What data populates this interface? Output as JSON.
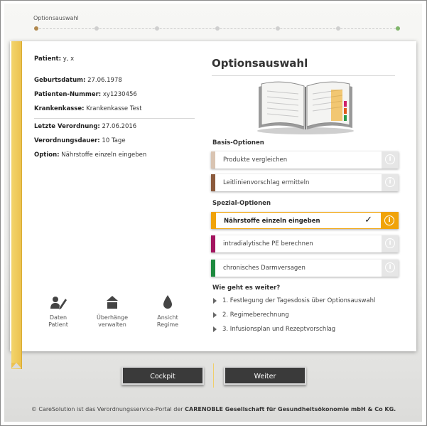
{
  "progress": {
    "title": "Optionsauswahl",
    "steps_total": 7,
    "current_step": 1,
    "accent": "#b0884d",
    "end_color": "#7fb56a"
  },
  "patient": {
    "label": "Patient:",
    "value": "y, x",
    "birth_label": "Geburtsdatum:",
    "birth_value": "27.06.1978",
    "number_label": "Patienten-Nummer:",
    "number_value": "xy1230456",
    "insurance_label": "Krankenkasse:",
    "insurance_value": "Krankenkasse Test",
    "last_label": "Letzte Verordnung:",
    "last_value": "27.06.2016",
    "duration_label": "Verordnungsdauer:",
    "duration_value": "10 Tage",
    "option_label": "Option:",
    "option_value": "Nährstoffe einzeln eingeben"
  },
  "tools": [
    {
      "line1": "Daten",
      "line2": "Patient",
      "icon": "edit-user-icon"
    },
    {
      "line1": "Überhänge",
      "line2": "verwalten",
      "icon": "stack-up-icon"
    },
    {
      "line1": "Ansicht",
      "line2": "Regime",
      "icon": "drop-icon"
    }
  ],
  "main": {
    "title": "Optionsauswahl",
    "basis_title": "Basis-Optionen",
    "spezial_title": "Spezial-Optionen",
    "options": [
      {
        "label": "Produkte vergleichen",
        "color": "#d9c4b2",
        "selected": false
      },
      {
        "label": "Leitlinienvorschlag ermitteln",
        "color": "#8b5a3c",
        "selected": false
      },
      {
        "label": "Nährstoffe einzeln eingeben",
        "color": "#f0a30a",
        "selected": true
      },
      {
        "label": "intradialytische PE berechnen",
        "color": "#a3145f",
        "selected": false
      },
      {
        "label": "chronisches Darmversagen",
        "color": "#1d8a3e",
        "selected": false
      }
    ],
    "info_glyph": "i",
    "check_glyph": "✓",
    "next_title": "Wie geht es weiter?",
    "steps": [
      "1. Festlegung der Tagesdosis über Optionsauswahl",
      "2. Regimeberechnung",
      "3. Infusionsplan und Rezeptvorschlag"
    ]
  },
  "buttons": {
    "cockpit": "Cockpit",
    "weiter": "Weiter"
  },
  "footer": {
    "prefix": "© CareSolution ist das Verordnungsservice-Portal der ",
    "company": "CARENOBLE Gesellschaft für Gesundheitsökonomie mbH & Co KG."
  }
}
